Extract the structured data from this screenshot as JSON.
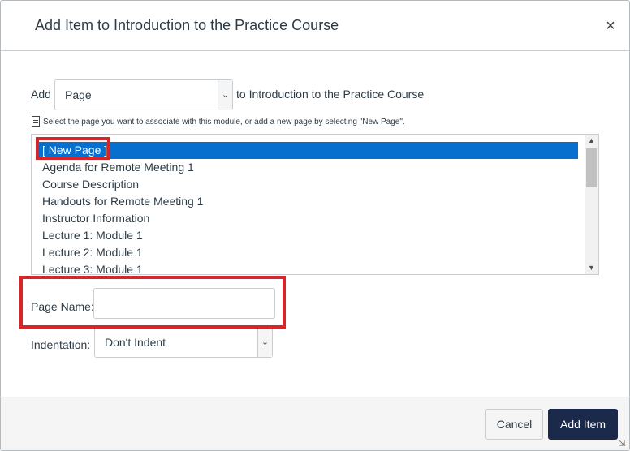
{
  "dialog": {
    "title": "Add Item to Introduction to the Practice Course",
    "close_label": "×"
  },
  "add_row": {
    "prefix": "Add",
    "type_value": "Page",
    "suffix": "to Introduction to the Practice Course"
  },
  "hint": {
    "icon": "document-icon",
    "text": "Select the page you want to associate with this module, or add a new page by selecting \"New Page\"."
  },
  "page_list": {
    "options": [
      "[ New Page ]",
      "Agenda for Remote Meeting 1",
      "Course Description",
      "Handouts for Remote Meeting 1",
      "Instructor Information",
      "Lecture 1: Module 1",
      "Lecture 2: Module 1",
      "Lecture 3: Module 1"
    ],
    "selected_index": 0
  },
  "page_name": {
    "label": "Page Name:",
    "value": ""
  },
  "indentation": {
    "label": "Indentation:",
    "value": "Don't Indent"
  },
  "footer": {
    "cancel_label": "Cancel",
    "add_label": "Add Item"
  },
  "colors": {
    "selection": "#0770cf",
    "highlight_box": "#d7252c",
    "primary_button": "#1b2a4b"
  }
}
